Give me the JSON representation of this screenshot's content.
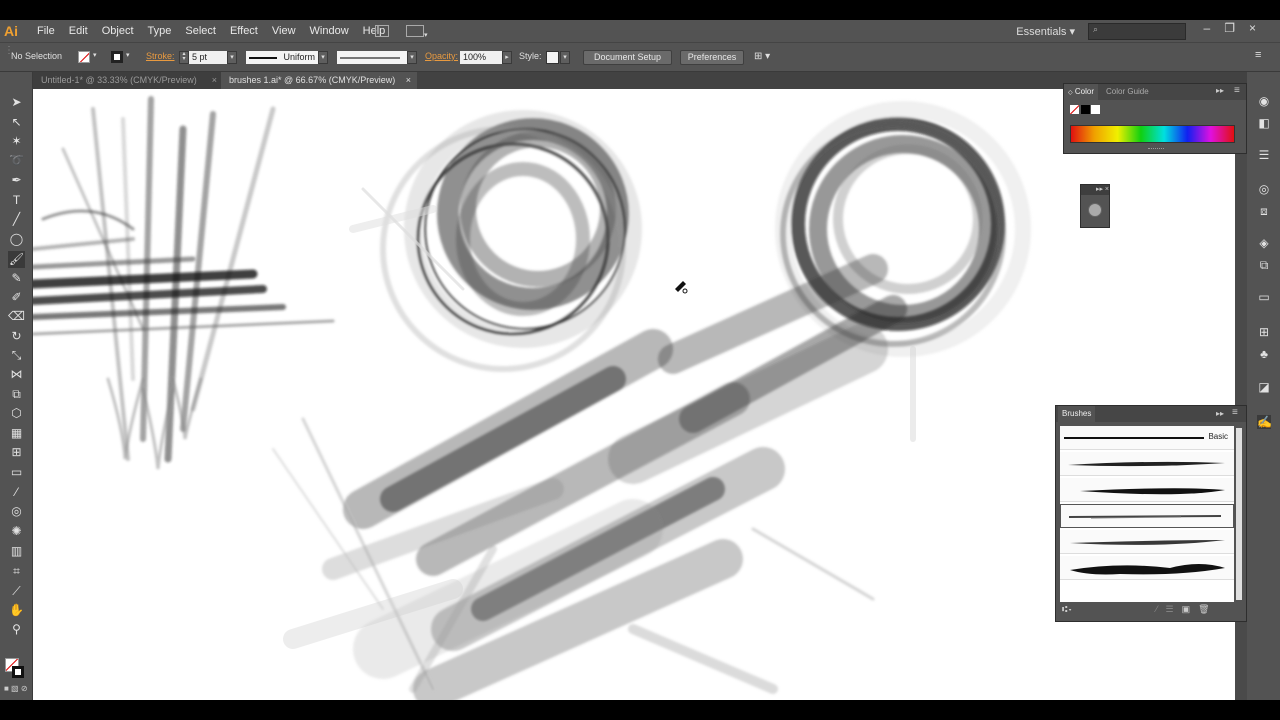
{
  "app": {
    "logo": "Ai"
  },
  "menu": [
    "File",
    "Edit",
    "Object",
    "Type",
    "Select",
    "Effect",
    "View",
    "Window",
    "Help"
  ],
  "workspace": {
    "label": "Essentials",
    "arrow": "▾"
  },
  "control": {
    "selection": "No Selection",
    "stroke_label": "Stroke:",
    "stroke_value": "5 pt",
    "profile": "Uniform",
    "opacity_label": "Opacity:",
    "opacity_value": "100%",
    "style_label": "Style:",
    "document_setup": "Document Setup",
    "preferences": "Preferences"
  },
  "tabs": [
    {
      "label": "Untitled-1* @ 33.33% (CMYK/Preview)",
      "close": "×"
    },
    {
      "label": "brushes 1.ai* @ 66.67% (CMYK/Preview)",
      "close": "×"
    }
  ],
  "color_panel": {
    "tabs": [
      "Color",
      "Color Guide"
    ],
    "menu_icon": "≡"
  },
  "brushes_panel": {
    "title": "Brushes",
    "rows": [
      "Basic",
      "",
      "",
      "",
      "",
      ""
    ],
    "selected_index": 3
  },
  "colors": {
    "ui": "#535353",
    "accent": "#e89a40",
    "canvas": "#ffffff"
  }
}
